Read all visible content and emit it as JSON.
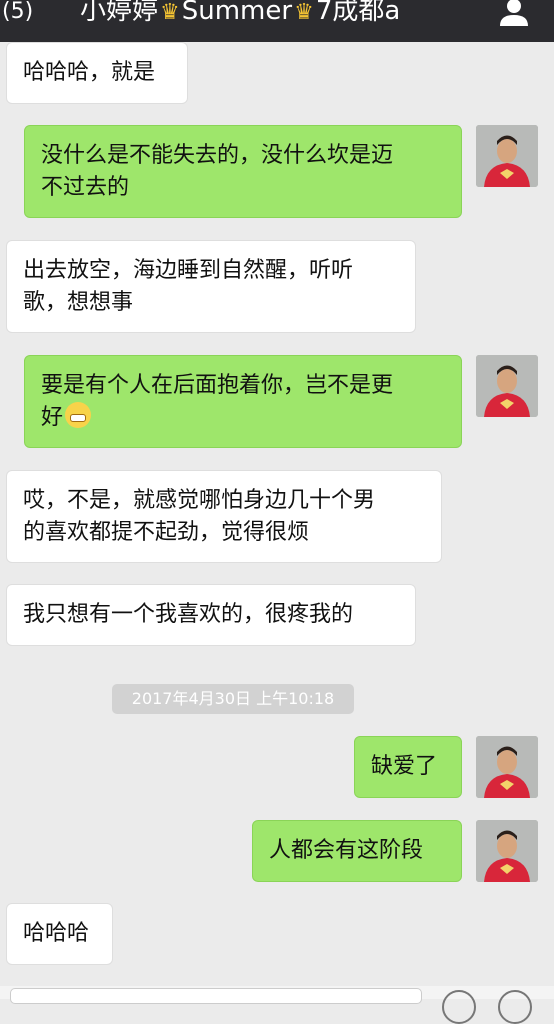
{
  "header": {
    "back_label": "(5)",
    "title_part1": "小婷婷",
    "title_part2": "Summer",
    "title_part3": "7成都a",
    "crown_icon": "crown-icon",
    "profile_icon": "person-icon"
  },
  "messages": [
    {
      "side": "in",
      "text": "哈哈哈，就是"
    },
    {
      "side": "out",
      "text_line1": "没什么是不能失去的，没什么坎是迈",
      "text_line2": "不过去的"
    },
    {
      "side": "in",
      "text_line1": "出去放空，海边睡到自然醒，听听",
      "text_line2": "歌，想想事"
    },
    {
      "side": "out",
      "text_line1": "要是有个人在后面抱着你，岂不是更",
      "text_line2": "好",
      "emoji": "grimacing-face-emoji"
    },
    {
      "side": "in",
      "text_line1": "哎，不是，就感觉哪怕身边几十个男",
      "text_line2": "的喜欢都提不起劲，觉得很烦"
    },
    {
      "side": "in",
      "text": "我只想有一个我喜欢的，很疼我的"
    },
    {
      "side": "out",
      "text": "缺爱了"
    },
    {
      "side": "out",
      "text": "人都会有这阶段"
    },
    {
      "side": "in",
      "text": "哈哈哈"
    }
  ],
  "timestamp": "2017年4月30日 上午10:18",
  "colors": {
    "topbar": "#2b2b2f",
    "outgoing_bubble": "#9ee66b",
    "incoming_bubble": "#ffffff",
    "background": "#ebebeb",
    "avatar_shirt": "#d8263a"
  }
}
